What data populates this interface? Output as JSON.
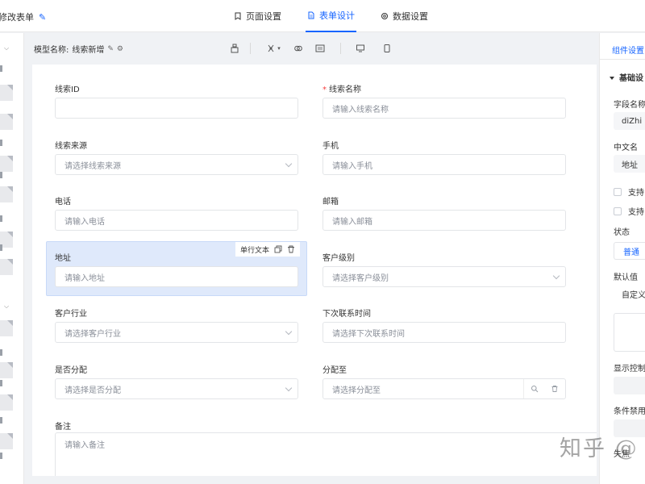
{
  "header": {
    "title": "修改表单",
    "tabs": [
      {
        "label": "页面设置",
        "icon": "bookmark-icon"
      },
      {
        "label": "表单设计",
        "icon": "document-icon",
        "active": true
      },
      {
        "label": "数据设置",
        "icon": "gear-icon"
      }
    ]
  },
  "toolbar": {
    "model_label": "模型名称:",
    "model_value": "线索新增"
  },
  "form": {
    "fields": [
      {
        "label": "线索ID",
        "placeholder": "",
        "required": false
      },
      {
        "label": "线索名称",
        "placeholder": "请输入线索名称",
        "required": true
      },
      {
        "label": "线索来源",
        "placeholder": "请选择线索来源"
      },
      {
        "label": "手机",
        "placeholder": "请输入手机"
      },
      {
        "label": "电话",
        "placeholder": "请输入电话"
      },
      {
        "label": "邮箱",
        "placeholder": "请输入邮箱"
      },
      {
        "label": "地址",
        "placeholder": "请输入地址"
      },
      {
        "label": "客户级别",
        "placeholder": "请选择客户级别"
      },
      {
        "label": "客户行业",
        "placeholder": "请选择客户行业"
      },
      {
        "label": "下次联系时间",
        "placeholder": "请选择下次联系时间"
      },
      {
        "label": "是否分配",
        "placeholder": "请选择是否分配"
      },
      {
        "label": "分配至",
        "placeholder": "请选择分配至"
      },
      {
        "label": "备注",
        "placeholder": "请输入备注"
      }
    ],
    "selected_tag": "单行文本"
  },
  "right_panel": {
    "tab": "组件设置",
    "section": "基础设",
    "field_name_label": "字段名称",
    "field_name_value": "diZhi",
    "cn_name_label": "中文名",
    "cn_name_value": "地址",
    "check1": "支持",
    "check2": "支持",
    "status_label": "状态",
    "status_value": "普通",
    "default_label": "默认值",
    "default_value": "自定义",
    "display_label": "显示控制",
    "disable_label": "条件禁用",
    "blur_label": "失焦"
  },
  "watermark": "知乎 @"
}
